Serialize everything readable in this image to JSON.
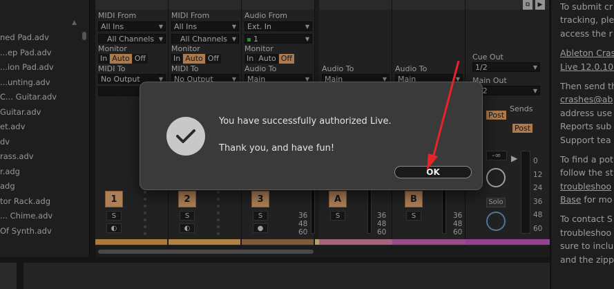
{
  "browser": {
    "items": [
      "ned Pad.adv",
      "...ep Pad.adv",
      "...ion Pad.adv",
      "...unting.adv",
      "C... Guitar.adv",
      "Guitar.adv",
      "et.adv",
      "dv",
      "rass.adv",
      "r.adg",
      "adg",
      "tor Rack.adg",
      "... Chime.adv",
      "Of Synth.adv"
    ]
  },
  "tracks": [
    {
      "midi_from_label": "MIDI From",
      "from": "All Ins",
      "channel": "All Channels",
      "monitor_label": "Monitor",
      "mon": [
        "In",
        "Auto",
        "Off"
      ],
      "to_label": "MIDI To",
      "to": "No Output",
      "num": "1"
    },
    {
      "midi_from_label": "MIDI From",
      "from": "All Ins",
      "channel": "All Channels",
      "monitor_label": "Monitor",
      "mon": [
        "In",
        "Auto",
        "Off"
      ],
      "to_label": "MIDI To",
      "to": "No Output",
      "num": "2"
    },
    {
      "midi_from_label": "Audio From",
      "from": "Ext. In",
      "channel": "1",
      "monitor_label": "Monitor",
      "mon": [
        "In",
        "Auto",
        "Off"
      ],
      "to_label": "Audio To",
      "to": "Main",
      "num": "3"
    }
  ],
  "returns": [
    {
      "to_label": "Audio To",
      "to": "Main",
      "num": "A"
    },
    {
      "to_label": "Audio To",
      "to": "Main",
      "num": "B"
    }
  ],
  "master": {
    "cue_label": "Cue Out",
    "cue": "1/2",
    "main_label": "Main Out",
    "main": "1/2",
    "sends_label": "Sends",
    "post1": "Post",
    "post2": "Post",
    "vol": "-∞",
    "solo": "Solo"
  },
  "mixer": {
    "solo_btn": "S",
    "db_ticks": [
      "36",
      "48",
      "60"
    ],
    "master_ticks": [
      "0",
      "12",
      "24",
      "36",
      "48",
      "60"
    ]
  },
  "dialog": {
    "line1": "You have successfully authorized Live.",
    "line2": "Thank you, and have fun!",
    "ok": "OK"
  },
  "help": {
    "lines": [
      {
        "t": "To submit cr",
        "u": false
      },
      {
        "t": "tracking, ple",
        "u": false
      },
      {
        "t": "access the r",
        "u": false
      },
      {
        "t": "",
        "u": false,
        "gap": true
      },
      {
        "t": "Ableton Cras",
        "u": true
      },
      {
        "t": "Live 12.0.10.",
        "u": true
      },
      {
        "t": "",
        "u": false,
        "gap": true
      },
      {
        "t": "Then send th",
        "u": false
      },
      {
        "t": "crashes@ab",
        "u": true
      },
      {
        "t": "address use",
        "u": false
      },
      {
        "t": "Reports sub",
        "u": false
      },
      {
        "t": "Support tea",
        "u": false
      },
      {
        "t": "",
        "u": false,
        "gap": true
      },
      {
        "t": "To find a pot",
        "u": false
      },
      {
        "t": "follow the st",
        "u": false
      },
      {
        "t": "troubleshoo",
        "u": true
      },
      {
        "t": "Base  for mo",
        "u": false,
        "base": true
      },
      {
        "t": "",
        "u": false,
        "gap": true
      },
      {
        "t": "To contact S",
        "u": false
      },
      {
        "t": "troubleshoo",
        "u": false
      },
      {
        "t": "sure to inclu",
        "u": false
      },
      {
        "t": "and the zipp",
        "u": false
      }
    ]
  },
  "colors": {
    "track1": "#f0a94a",
    "track2": "#f5b55a",
    "track3": "#b08050",
    "returnA": "#e78aa8",
    "returnB": "#d46ac0",
    "master": "#cc5ac8",
    "accent": "#f0a96b",
    "arrow": "#e8232a"
  }
}
